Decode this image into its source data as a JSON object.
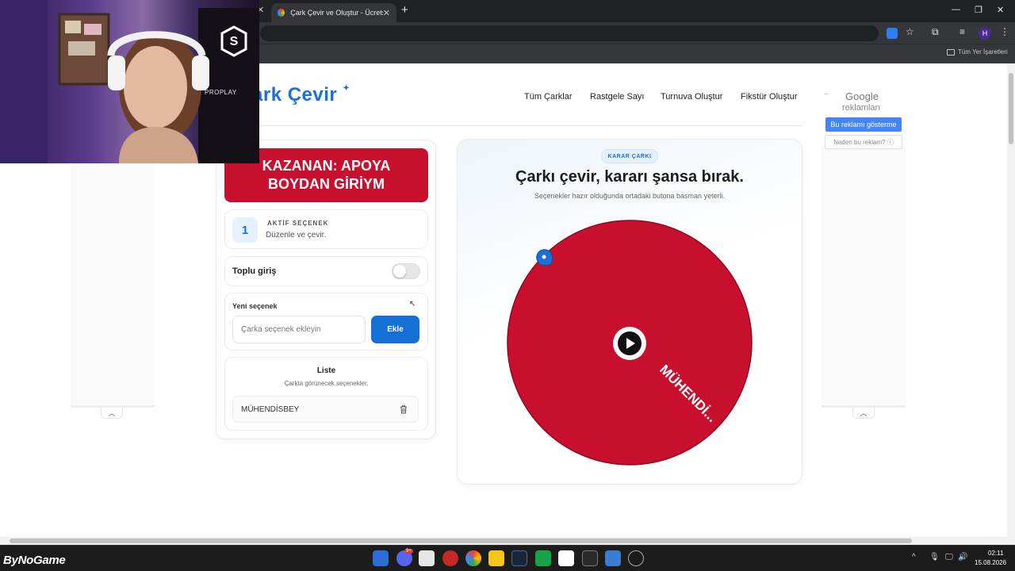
{
  "browser": {
    "active_tab_title": "Çark Çevir ve Oluştur - Ücretsiz",
    "bookmarks_folder": "Tüm Yer İşaretleri",
    "profile_initial": "H"
  },
  "header": {
    "logo": "ark Çevir",
    "nav": [
      "Tüm Çarklar",
      "Rastgele Sayı",
      "Turnuva Oluştur",
      "Fikstür Oluştur"
    ]
  },
  "ads": {
    "google": "Google",
    "reklamlari": "reklamları",
    "show_button": "Bu reklamı gösterme",
    "why_button": "Neden bu reklam? ⓘ"
  },
  "winner": {
    "line1": "KAZANAN: APOYA",
    "line2": "BOYDAN GİRİYM"
  },
  "active_options": {
    "count": "1",
    "title": "AKTİF SEÇENEK",
    "subtitle": "Düzenle ve çevir."
  },
  "bulk_entry": {
    "label": "Toplu giriş",
    "enabled": false
  },
  "new_option": {
    "label": "Yeni seçenek",
    "placeholder": "Çarka seçenek ekleyin",
    "value": "",
    "add_button": "Ekle"
  },
  "list": {
    "title": "Liste",
    "subtitle": "Çarkta görünecek seçenekler.",
    "items": [
      {
        "label": "MÜHENDİSBEY"
      }
    ]
  },
  "wheel": {
    "badge": "KARAR ÇARKI",
    "title": "Çarkı çevir, kararı şansa bırak.",
    "subtitle": "Seçenekler hazır olduğunda ortadaki butona basman yeterli.",
    "segment_label": "MÜHENDİ...",
    "segment_color": "#c8102e"
  },
  "webcam": {
    "brand": "PROPLAY"
  },
  "taskbar": {
    "brand": "ByNoGame",
    "time": "02:11",
    "date": "15.08.2026",
    "discord_badge": "9+"
  },
  "colors": {
    "accent": "#1570d6",
    "winner": "#c8102e",
    "wheel": "#c8102e"
  }
}
